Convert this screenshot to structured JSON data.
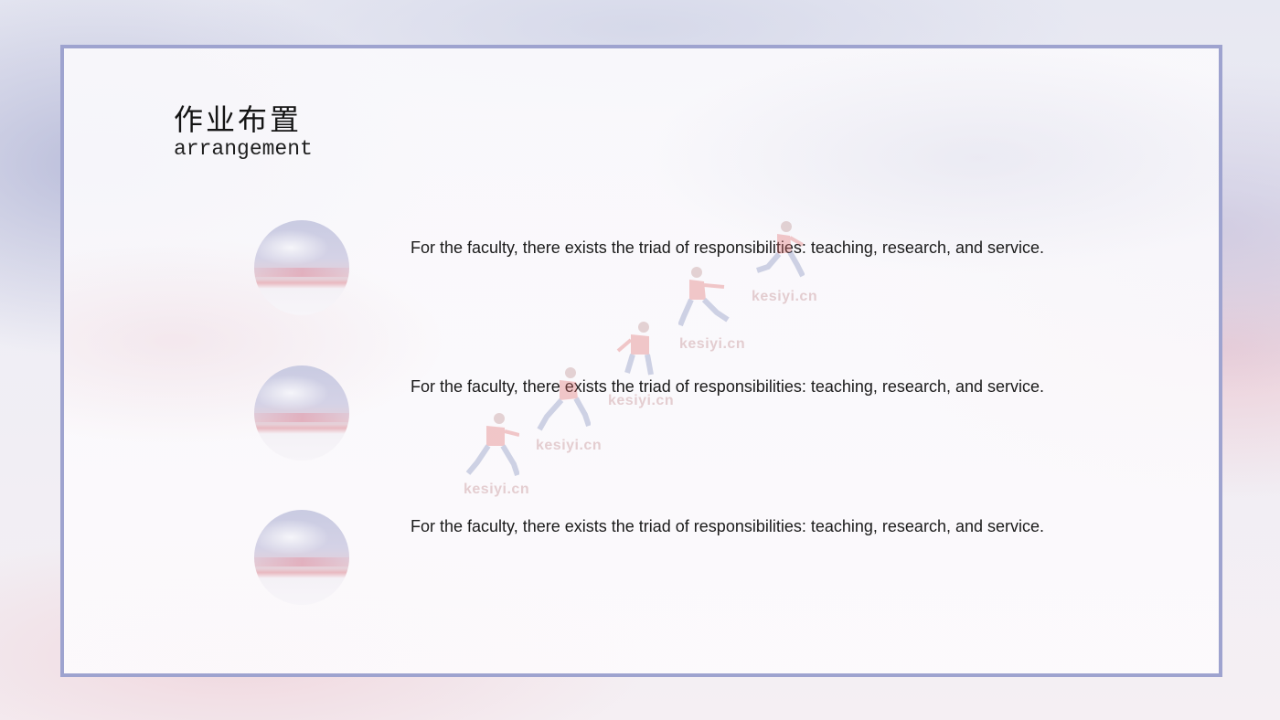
{
  "heading": {
    "title_zh": "作业布置",
    "title_en": "arrangement"
  },
  "items": [
    {
      "text": "For the faculty, there exists the triad of responsibilities: teaching, research, and service."
    },
    {
      "text": "For the faculty, there exists the triad of responsibilities: teaching, research, and service."
    },
    {
      "text": "For the faculty, there exists the triad of responsibilities: teaching, research, and service."
    }
  ],
  "watermark": "kesiyi.cn",
  "colors": {
    "frame_border": "#9ea3cf",
    "text": "#1b1b1b",
    "watermark": "#c8969c"
  }
}
